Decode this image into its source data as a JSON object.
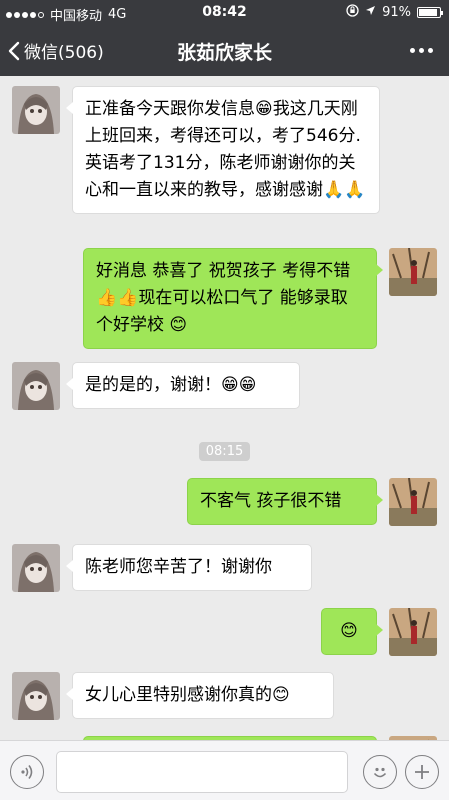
{
  "status_bar": {
    "carrier": "中国移动",
    "network": "4G",
    "time": "08:42",
    "battery_percent": "91%",
    "battery_level": 0.91
  },
  "nav": {
    "back_label": "微信(506)",
    "title": "张茹欣家长",
    "more_icon": "ellipsis-icon"
  },
  "messages": [
    {
      "side": "in",
      "text": "正准备今天跟你发信息😁我这几天刚上班回来，考得还可以，考了546分.英语考了131分，陈老师谢谢你的关心和一直以来的教导，感谢感谢🙏🙏"
    },
    {
      "side": "out",
      "text": "好消息 恭喜了 祝贺孩子 考得不错 👍👍现在可以松口气了 能够录取个好学校 😊"
    },
    {
      "side": "in",
      "text": "是的是的，谢谢！😁😁"
    },
    {
      "side": "out",
      "text": "不客气 孩子很不错"
    },
    {
      "side": "in",
      "text": "陈老师您辛苦了！谢谢你"
    },
    {
      "side": "out",
      "text": "😊"
    },
    {
      "side": "in",
      "text": "女儿心里特别感谢你真的😊"
    }
  ],
  "timestamp": "08:15",
  "colors": {
    "header_bg": "#393a3e",
    "chat_bg": "#ebebeb",
    "outgoing_bubble": "#9fe658",
    "incoming_bubble": "#ffffff"
  },
  "input_bar": {
    "voice_icon": "voice-icon",
    "emoji_icon": "emoji-icon",
    "plus_icon": "plus-icon",
    "placeholder": ""
  }
}
